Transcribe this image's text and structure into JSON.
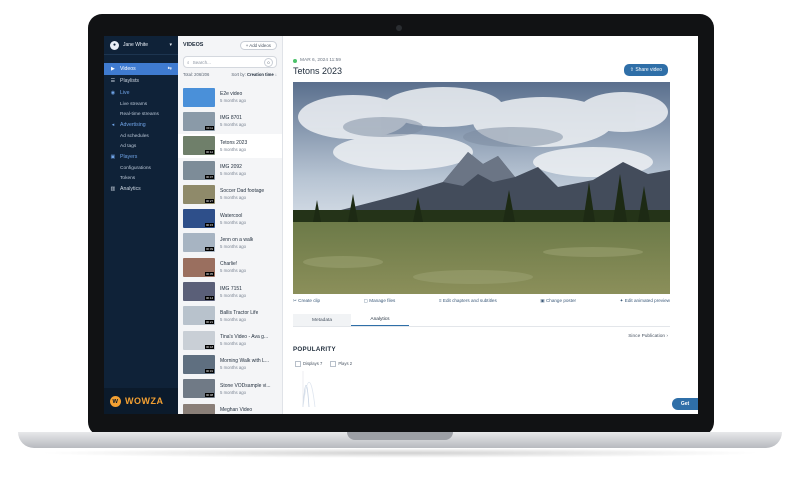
{
  "user": {
    "name": "Jane White"
  },
  "sidebar": {
    "items": [
      {
        "label": "Videos",
        "icon": "play-icon"
      },
      {
        "label": "Playlists",
        "icon": "list-icon"
      },
      {
        "label": "Live",
        "icon": "broadcast-icon"
      },
      {
        "label": "Live streams"
      },
      {
        "label": "Real-time streams"
      },
      {
        "label": "Advertising",
        "icon": "megaphone-icon"
      },
      {
        "label": "Ad schedules"
      },
      {
        "label": "Ad tags"
      },
      {
        "label": "Players",
        "icon": "player-icon"
      },
      {
        "label": "Configurations"
      },
      {
        "label": "Tokens"
      },
      {
        "label": "Analytics",
        "icon": "chart-icon"
      }
    ],
    "logo": "WOWZA"
  },
  "list": {
    "heading": "VIDEOS",
    "add_label": "+ Add videos",
    "search_placeholder": "Search...",
    "search_count": "0",
    "total": "Total: 206/206",
    "sort_prefix": "Sort by:",
    "sort_value": "Creation time",
    "videos": [
      {
        "title": "E2e video",
        "age": "5 months ago",
        "duration": ""
      },
      {
        "title": "IMG 8701",
        "age": "5 months ago",
        "duration": "00:11"
      },
      {
        "title": "Tetons 2023",
        "age": "5 months ago",
        "duration": "00:12"
      },
      {
        "title": "IMG 2092",
        "age": "5 months ago",
        "duration": "00:07"
      },
      {
        "title": "Soccer Dad footage",
        "age": "5 months ago",
        "duration": "00:27"
      },
      {
        "title": "Watercool",
        "age": "5 months ago",
        "duration": "00:15"
      },
      {
        "title": "Jenn on a walk",
        "age": "5 months ago",
        "duration": "00:09"
      },
      {
        "title": "Charlie!",
        "age": "5 months ago",
        "duration": "00:05"
      },
      {
        "title": "IMG 7151",
        "age": "5 months ago",
        "duration": "00:14"
      },
      {
        "title": "Ballis Tractor Life",
        "age": "5 months ago",
        "duration": "00:21"
      },
      {
        "title": "Tina's Video - Ava g...",
        "age": "5 months ago",
        "duration": "00:18"
      },
      {
        "title": "Morning Walk with L...",
        "age": "5 months ago",
        "duration": "00:31"
      },
      {
        "title": "Stone VODsample vi...",
        "age": "5 months ago",
        "duration": "00:08"
      },
      {
        "title": "Meghan Video",
        "age": "5 months ago",
        "duration": "00:10"
      }
    ]
  },
  "main": {
    "date": "MAR 6, 2024 11:59",
    "title": "Tetons 2023",
    "share_label": "Share video",
    "actions": [
      "Create clip",
      "Manage files",
      "Edit chapters and subtitles",
      "Change poster",
      "Edit animated preview"
    ],
    "tabs": [
      "Metadata",
      "Analytics"
    ],
    "since": "Since Publication",
    "popularity": "POPULARITY",
    "legend": [
      "Displays 7",
      "Plays 2"
    ],
    "get_label": "Get"
  }
}
